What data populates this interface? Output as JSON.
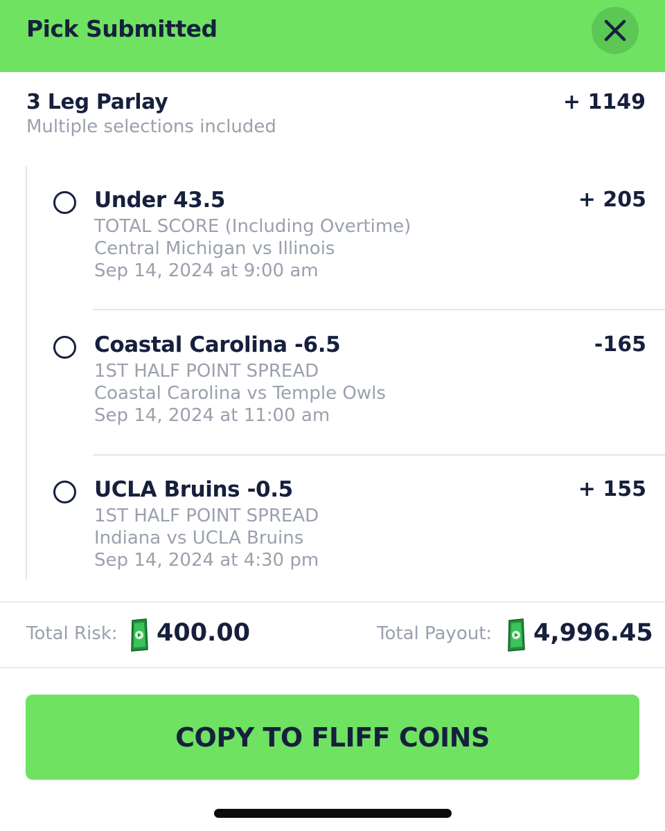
{
  "header": {
    "title": "Pick Submitted",
    "close_icon": "close-icon",
    "background_color": "#6fe262"
  },
  "parlay": {
    "title": "3 Leg Parlay",
    "subtitle": "Multiple selections included",
    "odds": "+ 1149"
  },
  "legs": [
    {
      "name": "Under 43.5",
      "odds": "+ 205",
      "market": "TOTAL SCORE (Including Overtime)",
      "matchup": "Central Michigan vs Illinois",
      "datetime": "Sep 14, 2024 at 9:00 am"
    },
    {
      "name": "Coastal Carolina -6.5",
      "odds": "-165",
      "market": "1ST HALF POINT SPREAD",
      "matchup": "Coastal Carolina vs Temple Owls",
      "datetime": "Sep 14, 2024 at 11:00 am"
    },
    {
      "name": "UCLA Bruins -0.5",
      "odds": "+ 155",
      "market": "1ST HALF POINT SPREAD",
      "matchup": "Indiana vs UCLA Bruins",
      "datetime": "Sep 14, 2024 at 4:30 pm"
    }
  ],
  "totals": {
    "risk_label": "Total Risk:",
    "risk_value": "400.00",
    "payout_label": "Total Payout:",
    "payout_value": "4,996.45",
    "currency_icon": "cash-coin-icon"
  },
  "actions": {
    "copy_label": "COPY TO FLIFF COINS",
    "button_color": "#6fe262"
  },
  "colors": {
    "primary_text": "#16203d",
    "secondary_text": "#9aa0ad",
    "accent_green": "#6fe262"
  }
}
